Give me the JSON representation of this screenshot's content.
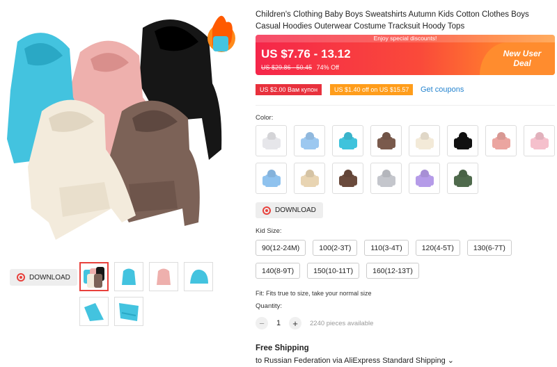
{
  "gallery": {
    "download_label": "DOWNLOAD",
    "thumbnails": [
      {
        "name": "thumb-group"
      },
      {
        "name": "thumb-blue"
      },
      {
        "name": "thumb-pink"
      },
      {
        "name": "thumb-blue-hood"
      },
      {
        "name": "thumb-blue-back"
      },
      {
        "name": "thumb-blue-detail"
      }
    ]
  },
  "product": {
    "title": "Children's Clothing Baby Boys Sweatshirts Autumn Kids Cotton Clothes Boys Casual Hoodies Outerwear Costume Tracksuit Hoody Tops",
    "promo_top": "Enjoy special discounts!",
    "price": "US $7.76 - 13.12",
    "original_price": "US $29.86 - 50.45",
    "discount": "74% Off",
    "new_user_line1": "New User",
    "new_user_line2": "Deal"
  },
  "coupons": {
    "coupon1": "US $2.00 Вам купон",
    "coupon2": "US $1.40 off on US $15.57",
    "get_coupons": "Get coupons"
  },
  "color": {
    "label": "Color:",
    "download_label": "DOWNLOAD",
    "swatches": [
      {
        "color": "#e6e6ea"
      },
      {
        "color": "#9cc8f0"
      },
      {
        "color": "#3fc3dc"
      },
      {
        "color": "#7a5a4c"
      },
      {
        "color": "#f3ead8"
      },
      {
        "color": "#111111"
      },
      {
        "color": "#eba5a0"
      },
      {
        "color": "#f5c0cc"
      },
      {
        "color": "#8fc2ee"
      },
      {
        "color": "#e8d4b2"
      },
      {
        "color": "#6a4a3c"
      },
      {
        "color": "#c4c6cc"
      },
      {
        "color": "#b59be8"
      },
      {
        "color": "#4f6a4c"
      }
    ]
  },
  "size": {
    "label": "Kid Size:",
    "options": [
      "90(12-24M)",
      "100(2-3T)",
      "110(3-4T)",
      "120(4-5T)",
      "130(6-7T)",
      "140(8-9T)",
      "150(10-11T)",
      "160(12-13T)"
    ],
    "fit": "Fit: Fits true to size, take your normal size"
  },
  "quantity": {
    "label": "Quantity:",
    "minus": "−",
    "value": "1",
    "plus": "+",
    "available": "2240 pieces available"
  },
  "shipping": {
    "title": "Free Shipping",
    "detail": "to Russian Federation via AliExpress Standard Shipping ⌄"
  }
}
